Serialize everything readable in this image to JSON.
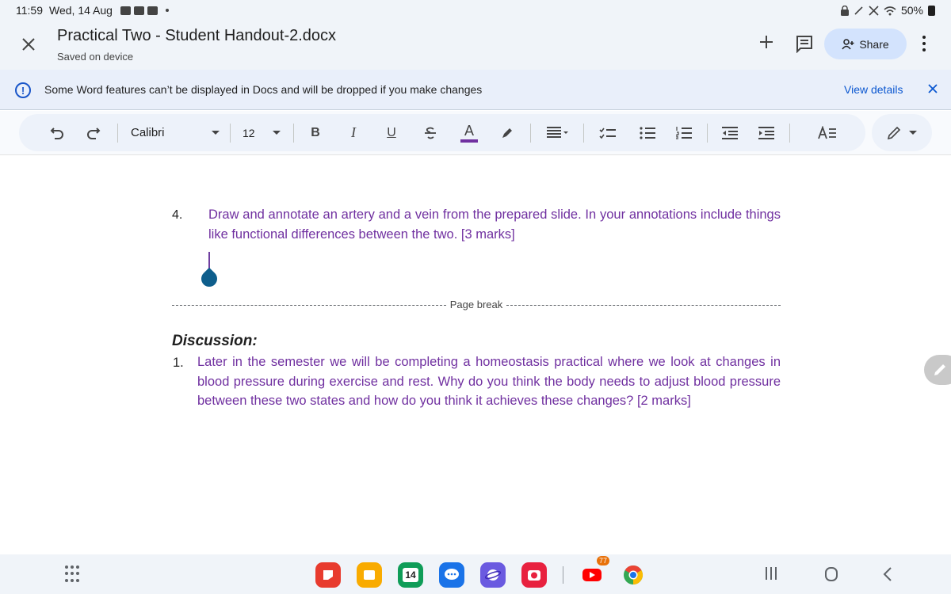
{
  "status_bar": {
    "time": "11:59",
    "date": "Wed, 14 Aug",
    "battery": "50%"
  },
  "header": {
    "title": "Practical Two - Student Handout-2.docx",
    "subtitle": "Saved on device",
    "share_label": "Share"
  },
  "warning": {
    "message": "Some Word features can’t be displayed in Docs and will be dropped if you make changes",
    "action": "View details"
  },
  "toolbar": {
    "font": "Calibri",
    "font_size": "12",
    "bold": "B",
    "italic": "I",
    "underline": "U",
    "text_color": "A",
    "text_color_hex": "#7030a0"
  },
  "document": {
    "question_number": "4.",
    "question_text": "Draw and annotate an artery and a vein from the prepared slide. In your annotations include things like functional differences between the two. [3 marks]",
    "page_break_label": "Page break",
    "discussion_title": "Discussion:",
    "discussion_number": "1.",
    "discussion_text": "Later in the semester we will be completing a homeostasis practical where we look at changes in blood pressure during exercise and rest. Why do you think the body needs to adjust blood pressure between these two states and how do you think it achieves these changes? [2 marks]"
  },
  "dock": {
    "calendar_day": "14",
    "youtube_badge": "77",
    "apps": [
      "flip-notes-icon",
      "notes-icon",
      "calendar-icon",
      "messages-icon",
      "internet-icon",
      "camera-icon",
      "youtube-icon",
      "chrome-icon"
    ]
  },
  "colors": {
    "accent": "#0b57d0",
    "doc_text": "#7030a0",
    "share_bg": "#d3e3fd"
  }
}
